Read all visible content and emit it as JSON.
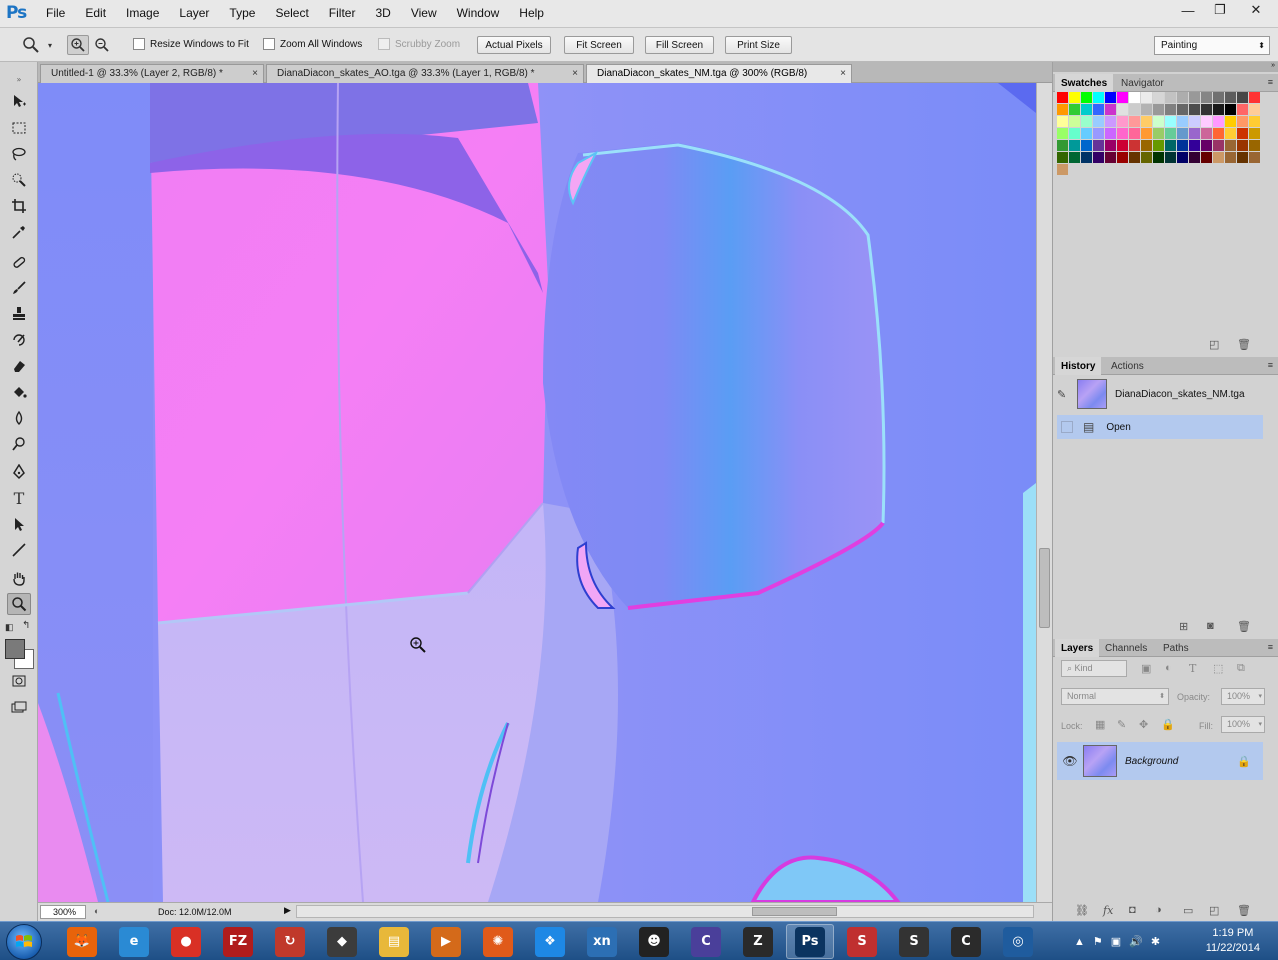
{
  "app": {
    "logo": "Ps"
  },
  "menu": [
    "File",
    "Edit",
    "Image",
    "Layer",
    "Type",
    "Select",
    "Filter",
    "3D",
    "View",
    "Window",
    "Help"
  ],
  "window_controls": {
    "minimize": "—",
    "restore": "❐",
    "close": "✕"
  },
  "options": {
    "resize_windows": "Resize Windows to Fit",
    "zoom_all": "Zoom All Windows",
    "scrubby_zoom": "Scrubby Zoom",
    "actual_pixels": "Actual Pixels",
    "fit_screen": "Fit Screen",
    "fill_screen": "Fill Screen",
    "print_size": "Print Size",
    "workspace": "Painting"
  },
  "tabs": [
    {
      "label": "Untitled-1 @ 33.3% (Layer 2, RGB/8) *",
      "active": false
    },
    {
      "label": "DianaDiacon_skates_AO.tga @ 33.3% (Layer 1, RGB/8) *",
      "active": false
    },
    {
      "label": "DianaDiacon_skates_NM.tga @ 300% (RGB/8)",
      "active": true
    }
  ],
  "tab_close": "×",
  "status": {
    "zoom": "300%",
    "doc": "Doc: 12.0M/12.0M"
  },
  "panels": {
    "swatches_tabs": [
      "Swatches",
      "Navigator"
    ],
    "history_tabs": [
      "History",
      "Actions"
    ],
    "history_snapshot": "DianaDiacon_skates_NM.tga",
    "history_items": [
      "Open"
    ],
    "layers_tabs": [
      "Layers",
      "Channels",
      "Paths"
    ],
    "kind_filter": "Kind",
    "blend_mode": "Normal",
    "opacity_label": "Opacity:",
    "opacity_value": "100%",
    "lock_label": "Lock:",
    "fill_label": "Fill:",
    "fill_value": "100%",
    "layer_name": "Background"
  },
  "swatch_colors": [
    "#ff0000",
    "#ffff00",
    "#00ff00",
    "#00ffff",
    "#0000ff",
    "#ff00ff",
    "#ffffff",
    "#ebebeb",
    "#d6d6d6",
    "#c2c2c2",
    "#adadad",
    "#999999",
    "#858585",
    "#707070",
    "#5c5c5c",
    "#474747",
    "#ff3333",
    "#ff9900",
    "#33cc33",
    "#00cccc",
    "#3366ff",
    "#cc33cc",
    "#e0e0e0",
    "#cccccc",
    "#b3b3b3",
    "#999999",
    "#808080",
    "#666666",
    "#4d4d4d",
    "#333333",
    "#1a1a1a",
    "#000000",
    "#ff6666",
    "#ffcc99",
    "#ffff99",
    "#ccff99",
    "#99ffcc",
    "#99ccff",
    "#cc99ff",
    "#ff99cc",
    "#ff9999",
    "#ffcc66",
    "#ccffcc",
    "#99ffff",
    "#99ccff",
    "#ccccff",
    "#ffccff",
    "#ff99ff",
    "#ffcc00",
    "#ff9966",
    "#ffcc33",
    "#99ff66",
    "#66ffcc",
    "#66ccff",
    "#9999ff",
    "#cc66ff",
    "#ff66cc",
    "#ff6699",
    "#ff9933",
    "#99cc66",
    "#66cc99",
    "#6699cc",
    "#9966cc",
    "#cc6699",
    "#ff6633",
    "#ffcc33",
    "#cc3300",
    "#cc9900",
    "#339933",
    "#009999",
    "#0066cc",
    "#663399",
    "#990066",
    "#cc0033",
    "#cc3333",
    "#996600",
    "#669900",
    "#006666",
    "#003399",
    "#330099",
    "#660066",
    "#993366",
    "#996633",
    "#993300",
    "#996600",
    "#336600",
    "#006633",
    "#003366",
    "#330066",
    "#660033",
    "#990000",
    "#663300",
    "#666600",
    "#003300",
    "#003333",
    "#000066",
    "#330033",
    "#660000",
    "#cc9966",
    "#996633",
    "#663300",
    "#996633",
    "#cc9966"
  ],
  "taskbar": {
    "apps": [
      {
        "name": "firefox",
        "glyph": "🦊",
        "color": "#e8630a"
      },
      {
        "name": "ie",
        "glyph": "e",
        "color": "#2a8ad4"
      },
      {
        "name": "chrome",
        "glyph": "●",
        "color": "#d93025"
      },
      {
        "name": "filezilla",
        "glyph": "FZ",
        "color": "#b01c1c"
      },
      {
        "name": "sync",
        "glyph": "↻",
        "color": "#c0392b"
      },
      {
        "name": "app-mask",
        "glyph": "◆",
        "color": "#3c3c3c"
      },
      {
        "name": "explorer",
        "glyph": "▤",
        "color": "#e8b83a"
      },
      {
        "name": "media",
        "glyph": "▶",
        "color": "#d46a1a"
      },
      {
        "name": "swirl",
        "glyph": "✺",
        "color": "#e05a1a"
      },
      {
        "name": "dropbox",
        "glyph": "❖",
        "color": "#1e88e5"
      },
      {
        "name": "xn",
        "glyph": "xn",
        "color": "#2c6fb4"
      },
      {
        "name": "gamer",
        "glyph": "☻",
        "color": "#222222"
      },
      {
        "name": "corel",
        "glyph": "C",
        "color": "#4a3f9a"
      },
      {
        "name": "zbrush",
        "glyph": "Z",
        "color": "#2a2a2a"
      },
      {
        "name": "photoshop",
        "glyph": "Ps",
        "color": "#0b3460"
      },
      {
        "name": "substance",
        "glyph": "S",
        "color": "#c03030"
      },
      {
        "name": "sg",
        "glyph": "S",
        "color": "#333333"
      },
      {
        "name": "c-app",
        "glyph": "C",
        "color": "#2b2b2b"
      },
      {
        "name": "blender",
        "glyph": "◎",
        "color": "#1f5c9e"
      }
    ],
    "time": "1:19 PM",
    "date": "11/22/2014"
  }
}
